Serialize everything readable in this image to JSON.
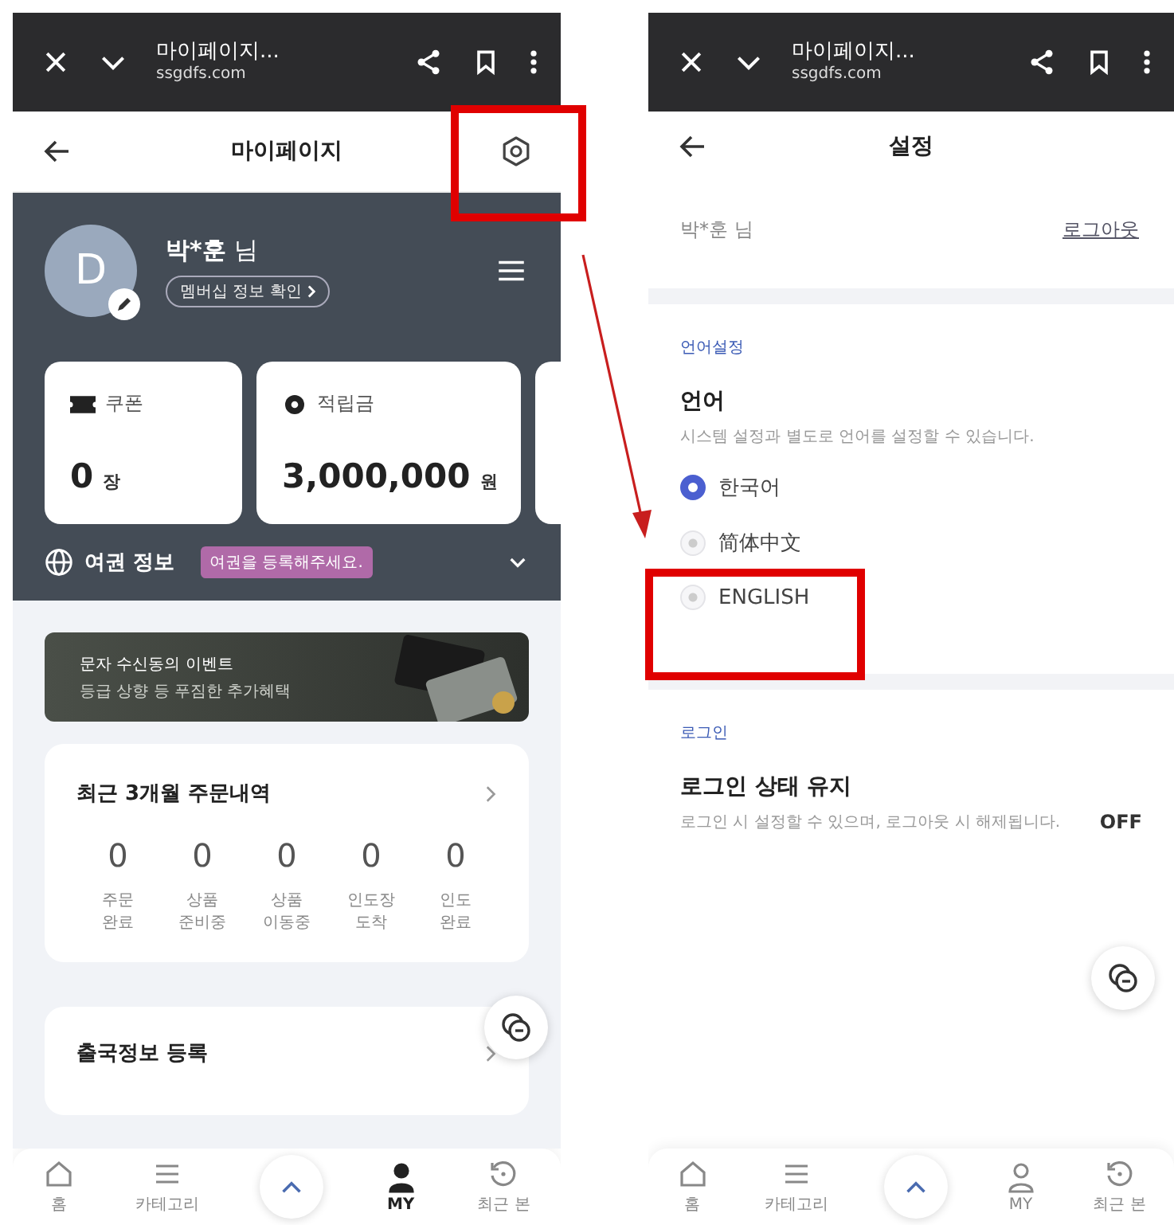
{
  "my_page": {
    "browser": {
      "title": "마이페이지...",
      "url": "ssgdfs.com"
    },
    "header": {
      "title": "마이페이지"
    },
    "profile": {
      "avatar_initial": "D",
      "name": "박*훈",
      "honorific": "님",
      "membership_link": "멤버십 정보 확인"
    },
    "cards": [
      {
        "kind": "coupon",
        "label": "쿠폰",
        "value": "0",
        "unit": "장"
      },
      {
        "kind": "points",
        "label": "적립금",
        "value": "3,000,000",
        "unit": "원"
      }
    ],
    "passport": {
      "label": "여권 정보",
      "badge": "여권을 등록해주세요."
    },
    "banner": {
      "title": "문자 수신동의 이벤트",
      "subtitle": "등급 상향 등 푸짐한 추가혜택"
    },
    "orders": {
      "title": "최근 3개월 주문내역",
      "stats": [
        {
          "value": "0",
          "label": "주문\n완료"
        },
        {
          "value": "0",
          "label": "상품\n준비중"
        },
        {
          "value": "0",
          "label": "상품\n이동중"
        },
        {
          "value": "0",
          "label": "인도장\n도착"
        },
        {
          "value": "0",
          "label": "인도\n완료"
        }
      ]
    },
    "departure": {
      "title": "출국정보 등록"
    },
    "nav": [
      {
        "kind": "home",
        "label": "홈",
        "selected": false
      },
      {
        "kind": "category",
        "label": "카테고리",
        "selected": false
      },
      {
        "kind": "top"
      },
      {
        "kind": "my",
        "label": "MY",
        "selected": true
      },
      {
        "kind": "recent",
        "label": "최근 본",
        "selected": false
      }
    ]
  },
  "settings_page": {
    "browser": {
      "title": "마이페이지...",
      "url": "ssgdfs.com"
    },
    "header": {
      "title": "설정"
    },
    "user": {
      "name": "박*훈 님",
      "logout": "로그아웃"
    },
    "language": {
      "section": "언어설정",
      "title": "언어",
      "description": "시스템 설정과 별도로 언어를 설정할 수 있습니다.",
      "options": [
        {
          "label": "한국어",
          "selected": true
        },
        {
          "label": "简体中文",
          "selected": false
        },
        {
          "label": "ENGLISH",
          "selected": false
        }
      ]
    },
    "login": {
      "section": "로그인",
      "title": "로그인 상태 유지",
      "description": "로그인 시 설정할 수 있으며, 로그아웃 시 해제됩니다.",
      "state": "OFF"
    },
    "nav": [
      {
        "kind": "home",
        "label": "홈",
        "selected": false
      },
      {
        "kind": "category",
        "label": "카테고리",
        "selected": false
      },
      {
        "kind": "top"
      },
      {
        "kind": "my",
        "label": "MY",
        "selected": false
      },
      {
        "kind": "recent",
        "label": "최근 본",
        "selected": false
      }
    ]
  }
}
